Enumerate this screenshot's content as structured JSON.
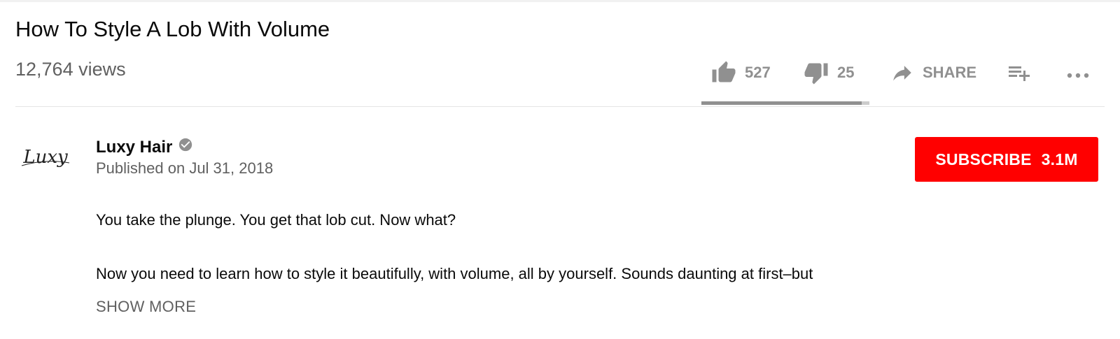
{
  "video": {
    "title": "How To Style A Lob With Volume",
    "views": "12,764 views"
  },
  "actions": {
    "likes": "527",
    "dislikes": "25",
    "share_label": "SHARE",
    "like_ratio": 0.955
  },
  "icons": {
    "like": "thumbs-up-icon",
    "dislike": "thumbs-down-icon",
    "share": "share-arrow-icon",
    "add_to_playlist": "playlist-add-icon",
    "more": "more-horizontal-icon",
    "verified": "verified-check-icon"
  },
  "channel": {
    "name": "Luxy Hair",
    "logo_text": "Luxy",
    "published": "Published on Jul 31, 2018"
  },
  "subscribe": {
    "label": "SUBSCRIBE",
    "count": "3.1M"
  },
  "description": {
    "line1": "You take the plunge. You get that lob cut. Now what?",
    "line2": "Now you need to learn how to style it beautifully, with volume, all by yourself. Sounds daunting at first–but",
    "show_more": "SHOW MORE"
  },
  "colors": {
    "subscribe_bg": "#ff0000",
    "icon_gray": "#909090",
    "secondary_text": "#606060"
  }
}
